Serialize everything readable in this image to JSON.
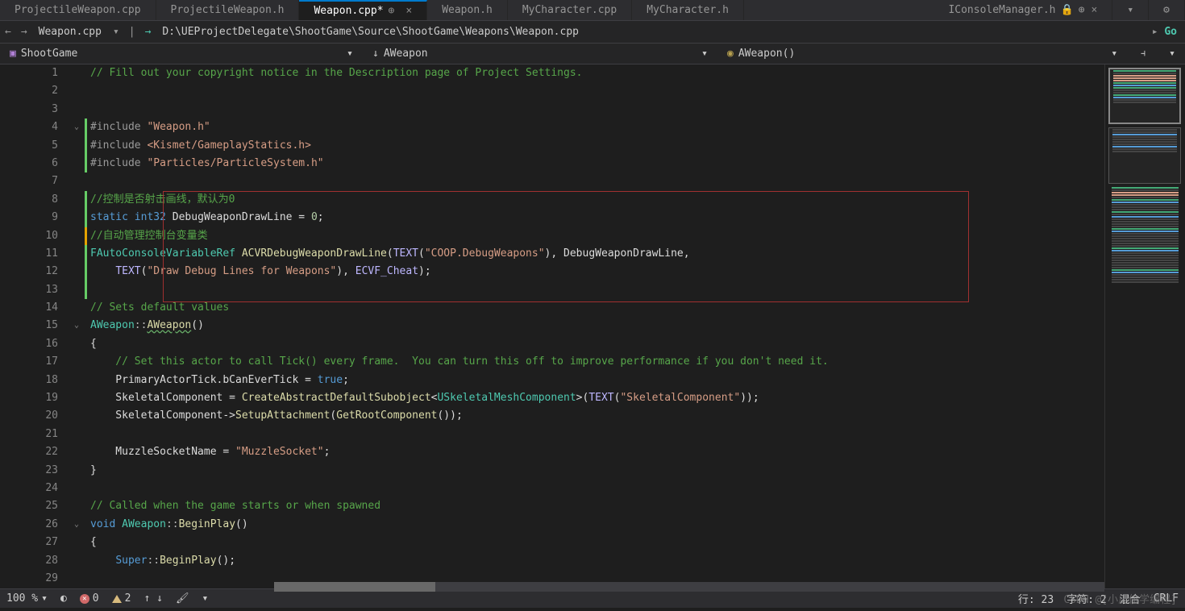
{
  "tabs": [
    {
      "label": "ProjectileWeapon.cpp"
    },
    {
      "label": "ProjectileWeapon.h"
    },
    {
      "label": "Weapon.cpp*",
      "active": true
    },
    {
      "label": "Weapon.h"
    },
    {
      "label": "MyCharacter.cpp"
    },
    {
      "label": "MyCharacter.h"
    }
  ],
  "tab_right": {
    "label": "IConsoleManager.h"
  },
  "nav": {
    "file": "Weapon.cpp",
    "path": "D:\\UEProjectDelegate\\ShootGame\\Source\\ShootGame\\Weapons\\Weapon.cpp",
    "go": "Go"
  },
  "crumbs": {
    "module": "ShootGame",
    "class": "AWeapon",
    "method": "AWeapon()"
  },
  "lines": [
    "1",
    "2",
    "3",
    "4",
    "5",
    "6",
    "7",
    "8",
    "9",
    "10",
    "11",
    "12",
    "13",
    "14",
    "15",
    "16",
    "17",
    "18",
    "19",
    "20",
    "21",
    "22",
    "23",
    "24",
    "25",
    "26",
    "27",
    "28",
    "29"
  ],
  "code": {
    "l1": "// Fill out your copyright notice in the Description page of Project Settings.",
    "l4a": "#include ",
    "l4b": "\"Weapon.h\"",
    "l5a": "#include ",
    "l5b": "<Kismet/GameplayStatics.h>",
    "l6a": "#include ",
    "l6b": "\"Particles/ParticleSystem.h\"",
    "l8": "//控制是否射击画线，默认为0",
    "l9a": "static",
    "l9b": " int32",
    "l9c": " DebugWeaponDrawLine = ",
    "l9d": "0",
    "l9e": ";",
    "l10": "//自动管理控制台变量类",
    "l11a": "FAutoConsoleVariableRef",
    "l11b": " ACVRDebugWeaponDrawLine",
    "l11c": "(",
    "l11d": "TEXT",
    "l11e": "(",
    "l11f": "\"COOP.DebugWeapons\"",
    "l11g": "), DebugWeaponDrawLine,",
    "l12a": "    ",
    "l12b": "TEXT",
    "l12c": "(",
    "l12d": "\"Draw Debug Lines for Weapons\"",
    "l12e": "), ",
    "l12f": "ECVF_Cheat",
    "l12g": ");",
    "l14": "// Sets default values",
    "l15a": "AWeapon",
    "l15b": "::",
    "l15c": "AWeapon",
    "l15d": "()",
    "l16": "{",
    "l17": "    // Set this actor to call Tick() every frame.  You can turn this off to improve performance if you don't need it.",
    "l18a": "    PrimaryActorTick.bCanEverTick = ",
    "l18b": "true",
    "l18c": ";",
    "l19a": "    SkeletalComponent = ",
    "l19b": "CreateAbstractDefaultSubobject",
    "l19c": "<",
    "l19d": "USkeletalMeshComponent",
    "l19e": ">(",
    "l19f": "TEXT",
    "l19g": "(",
    "l19h": "\"SkeletalComponent\"",
    "l19i": "));",
    "l20a": "    SkeletalComponent->",
    "l20b": "SetupAttachment",
    "l20c": "(",
    "l20d": "GetRootComponent",
    "l20e": "());",
    "l22a": "    MuzzleSocketName = ",
    "l22b": "\"MuzzleSocket\"",
    "l22c": ";",
    "l23": "}",
    "l25": "// Called when the game starts or when spawned",
    "l26a": "void",
    "l26b": " AWeapon",
    "l26c": "::",
    "l26d": "BeginPlay",
    "l26e": "()",
    "l27": "{",
    "l28a": "    ",
    "l28b": "Super",
    "l28c": "::",
    "l28d": "BeginPlay",
    "l28e": "();"
  },
  "status": {
    "zoom": "100 %",
    "errors": "0",
    "warnings": "2",
    "arrows": "↑ ↓",
    "line": "行: 23",
    "char": "字符: 2",
    "mixed": "混合",
    "crlf": "CRLF"
  },
  "watermark": "CSDN @[小瓜偷学编程]"
}
